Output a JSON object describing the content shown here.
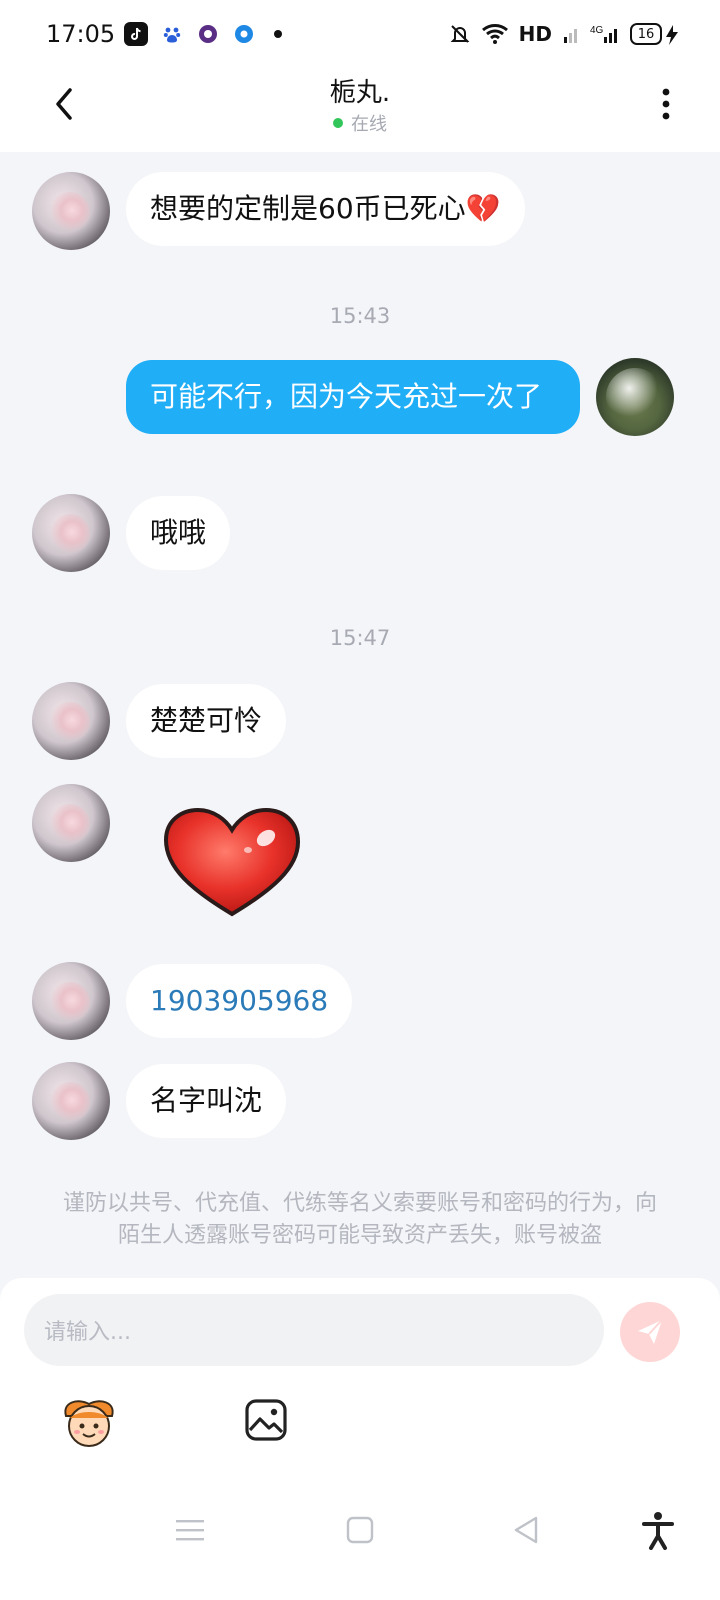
{
  "status_bar": {
    "time": "17:05",
    "network": "HD",
    "battery": "16"
  },
  "header": {
    "title": "栀丸.",
    "status": "在线"
  },
  "messages": [
    {
      "type": "received",
      "text": "想要的定制是60币已死心💔"
    },
    {
      "type": "timestamp",
      "text": "15:43"
    },
    {
      "type": "sent",
      "text": "可能不行，因为今天充过一次了"
    },
    {
      "type": "received",
      "text": "哦哦"
    },
    {
      "type": "timestamp",
      "text": "15:47"
    },
    {
      "type": "received",
      "text": "楚楚可怜"
    },
    {
      "type": "received_sticker",
      "sticker": "red-heart"
    },
    {
      "type": "received",
      "text": "1903905968"
    },
    {
      "type": "received",
      "text": "名字叫沈"
    }
  ],
  "notice": "谨防以共号、代充值、代练等名义索要账号和密码的行为，向陌生人透露账号密码可能导致资产丢失，账号被盗",
  "input": {
    "placeholder": "请输入..."
  },
  "colors": {
    "sent_bubble": "#20aef7",
    "link": "#2b7bb9",
    "online": "#32c55a",
    "send_button_bg": "#ffd6d6"
  },
  "icons": [
    "back-arrow-icon",
    "more-vertical-icon",
    "send-icon",
    "emoji-icon",
    "image-icon",
    "menu-icon",
    "home-square-icon",
    "back-triangle-icon",
    "accessibility-icon"
  ]
}
